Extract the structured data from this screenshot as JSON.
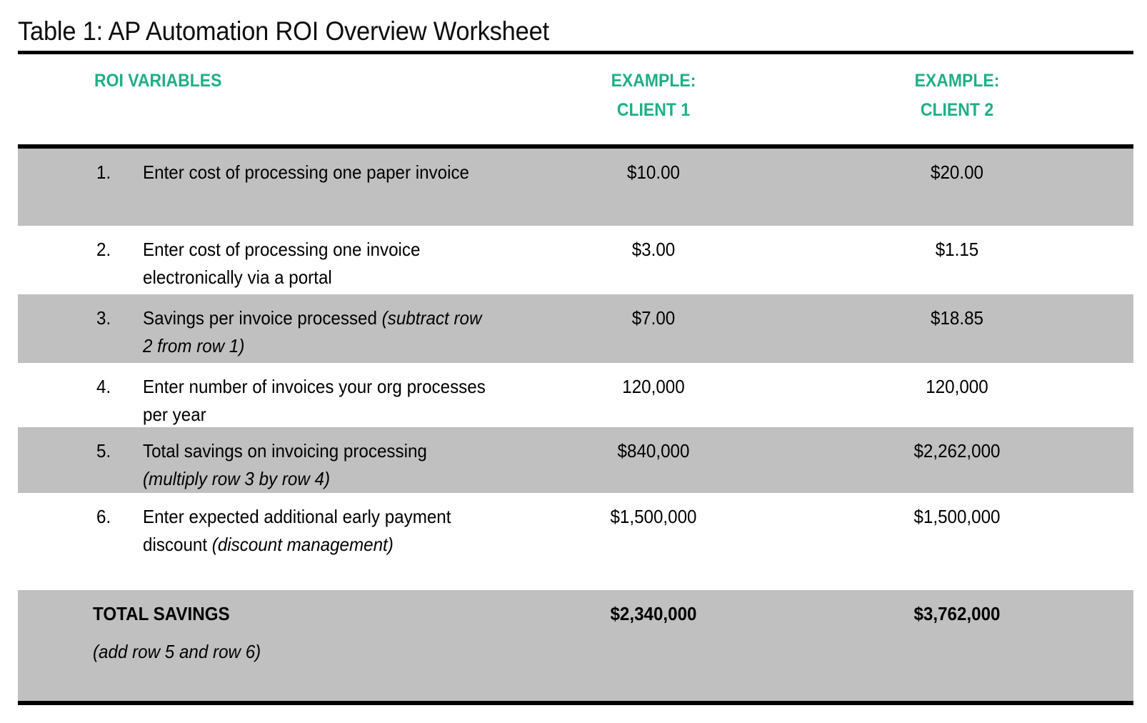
{
  "title": "Table 1: AP Automation ROI Overview Worksheet",
  "colors": {
    "accent_green": "#1FAE87",
    "row_shade": "#C0C0C0",
    "rule": "#000000",
    "text": "#000000"
  },
  "header": {
    "col_variables": "ROI VARIABLES",
    "col_client1_line1": "EXAMPLE:",
    "col_client1_line2": "CLIENT 1",
    "col_client2_line1": "EXAMPLE:",
    "col_client2_line2": "CLIENT 2"
  },
  "chart_data": {
    "type": "table",
    "title": "Table 1: AP Automation ROI Overview Worksheet",
    "columns": [
      "ROI VARIABLES",
      "EXAMPLE: CLIENT 1",
      "EXAMPLE: CLIENT 2"
    ],
    "rows": [
      {
        "num": "1.",
        "label": "Enter cost of processing one paper invoice",
        "client1": "$10.00",
        "client2": "$20.00"
      },
      {
        "num": "2.",
        "label": "Enter cost of processing one invoice electronically via a portal",
        "client1": "$3.00",
        "client2": "$1.15"
      },
      {
        "num": "3.",
        "label": "Savings per invoice processed (subtract row 2 from row 1)",
        "client1": "$7.00",
        "client2": "$18.85"
      },
      {
        "num": "4.",
        "label": "Enter number of invoices your org processes per year",
        "client1": "120,000",
        "client2": "120,000"
      },
      {
        "num": "5.",
        "label": "Total savings on invoicing processing (multiply row 3 by row 4)",
        "client1": "$840,000",
        "client2": "$2,262,000"
      },
      {
        "num": "6.",
        "label": "Enter expected additional early payment discount (discount management)",
        "client1": "$1,500,000",
        "client2": "$1,500,000"
      },
      {
        "num": "",
        "label": "TOTAL SAVINGS (add row 5 and row 6)",
        "client1": "$2,340,000",
        "client2": "$3,762,000"
      }
    ]
  },
  "rows": [
    {
      "num": "1.",
      "label_plain": "Enter cost of processing one paper invoice",
      "label_italic": "",
      "client1": "$10.00",
      "client2": "$20.00"
    },
    {
      "num": "2.",
      "label_plain": "Enter cost of processing one invoice electronically via a portal",
      "label_italic": "",
      "client1": "$3.00",
      "client2": "$1.15"
    },
    {
      "num": "3.",
      "label_plain": "Savings per invoice processed ",
      "label_italic": "(subtract row 2 from row 1)",
      "client1": "$7.00",
      "client2": "$18.85"
    },
    {
      "num": "4.",
      "label_plain": "Enter number of invoices your org processes per year",
      "label_italic": "",
      "client1": "120,000",
      "client2": "120,000"
    },
    {
      "num": "5.",
      "label_plain": "Total savings on invoicing processing ",
      "label_italic": "(multiply row 3 by row 4)",
      "client1": "$840,000",
      "client2": "$2,262,000"
    },
    {
      "num": "6.",
      "label_plain": "Enter expected additional early payment discount ",
      "label_italic": "(discount management)",
      "client1": "$1,500,000",
      "client2": "$1,500,000"
    }
  ],
  "total_row": {
    "label": "TOTAL SAVINGS",
    "sublabel": "(add row 5 and row 6)",
    "client1": "$2,340,000",
    "client2": "$3,762,000"
  }
}
